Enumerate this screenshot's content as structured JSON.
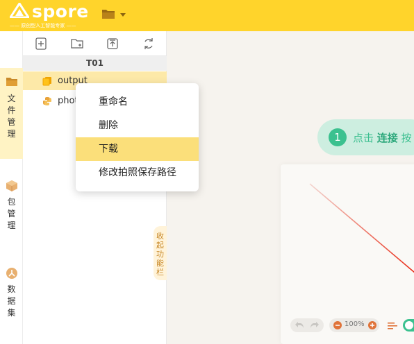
{
  "app": {
    "logo_text": "spore",
    "logo_tagline": "—— 原创型人工智能专家 ——"
  },
  "colors": {
    "topbar": "#ffd42b",
    "accent_green": "#3bc18f",
    "selected_row": "#fde9a8",
    "menu_highlight": "#fbdf7a"
  },
  "sidebar": {
    "items": [
      {
        "label": "文件管理",
        "icon": "folder-icon",
        "active": true
      },
      {
        "label": "包管理",
        "icon": "package-icon",
        "active": false
      },
      {
        "label": "数据集",
        "icon": "dataset-icon",
        "active": false
      }
    ]
  },
  "file_panel": {
    "toolbar_icons": [
      "new-file-icon",
      "new-folder-icon",
      "upload-icon",
      "refresh-icon"
    ],
    "tree_header": "T01",
    "rows": [
      {
        "name": "output",
        "icon": "file-copy-icon",
        "selected": true
      },
      {
        "name": "phot",
        "icon": "python-file-icon",
        "selected": false
      }
    ],
    "collapse_label": [
      "收",
      "起",
      "功",
      "能",
      "栏"
    ]
  },
  "context_menu": {
    "items": [
      {
        "label": "重命名",
        "highlighted": false
      },
      {
        "label": "删除",
        "highlighted": false
      },
      {
        "label": "下载",
        "highlighted": true
      },
      {
        "label": "修改拍照保存路径",
        "highlighted": false
      }
    ]
  },
  "main": {
    "hint_number": "1",
    "hint_prefix": "点击",
    "hint_bold": "连接",
    "hint_suffix": "按",
    "zoom_level": "100%"
  }
}
